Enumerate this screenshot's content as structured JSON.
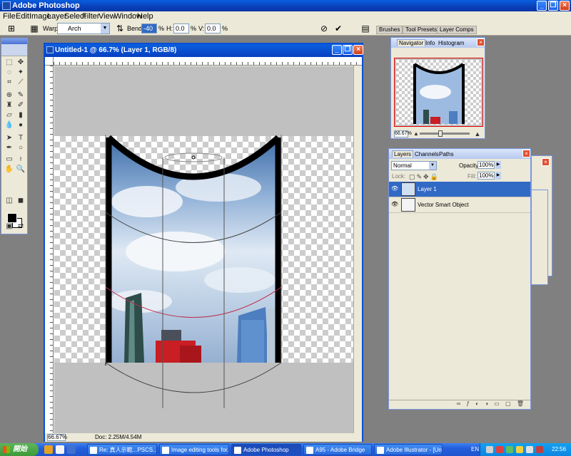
{
  "app": {
    "title": "Adobe Photoshop",
    "window_buttons": [
      "_",
      "❐",
      "×"
    ]
  },
  "menu": [
    "File",
    "Edit",
    "Image",
    "Layer",
    "Select",
    "Filter",
    "View",
    "Window",
    "Help"
  ],
  "options": {
    "warp_label": "Warp:",
    "warp_value": "Arch",
    "bend_label": "Bend:",
    "bend_value": "-40",
    "h_label": "H:",
    "h_value": "0.0",
    "v_label": "V:",
    "v_value": "0.0",
    "percent": "%",
    "well_tabs": [
      "Brushes",
      "Tool Presets",
      "Layer Comps"
    ]
  },
  "document": {
    "title": "Untitled-1 @ 66.7% (Layer 1, RGB/8)",
    "zoom": "66.67%",
    "doc_info": "Doc: 2.25M/4.54M"
  },
  "navigator": {
    "tabs": [
      "Navigator",
      "Info",
      "Histogram"
    ],
    "zoom": "66.67%",
    "slider_fraction": 0.4
  },
  "layers": {
    "tabs": [
      "Layers",
      "Channels",
      "Paths"
    ],
    "blend_mode": "Normal",
    "opacity_label": "Opacity:",
    "opacity_value": "100%",
    "lock_label": "Lock:",
    "fill_label": "Fill:",
    "fill_value": "100%",
    "items": [
      {
        "name": "Layer 1",
        "selected": true
      },
      {
        "name": "Vector Smart Object",
        "selected": false
      }
    ]
  },
  "taskbar": {
    "start_label": "開始",
    "buttons": [
      {
        "label": "Re: 真人示範...PSCS...",
        "active": false
      },
      {
        "label": "Image editing tools for...",
        "active": false
      },
      {
        "label": "Adobe Photoshop",
        "active": true
      },
      {
        "label": "A95 - Adobe Bridge",
        "active": false
      },
      {
        "label": "Adobe Illustrator - [Un...",
        "active": false
      }
    ],
    "lang": "EN",
    "clock": "22:56"
  },
  "colors": {
    "xp_blue": "#0a4fd0",
    "selected": "#316ac5",
    "panel_bg": "#ece9d8"
  }
}
